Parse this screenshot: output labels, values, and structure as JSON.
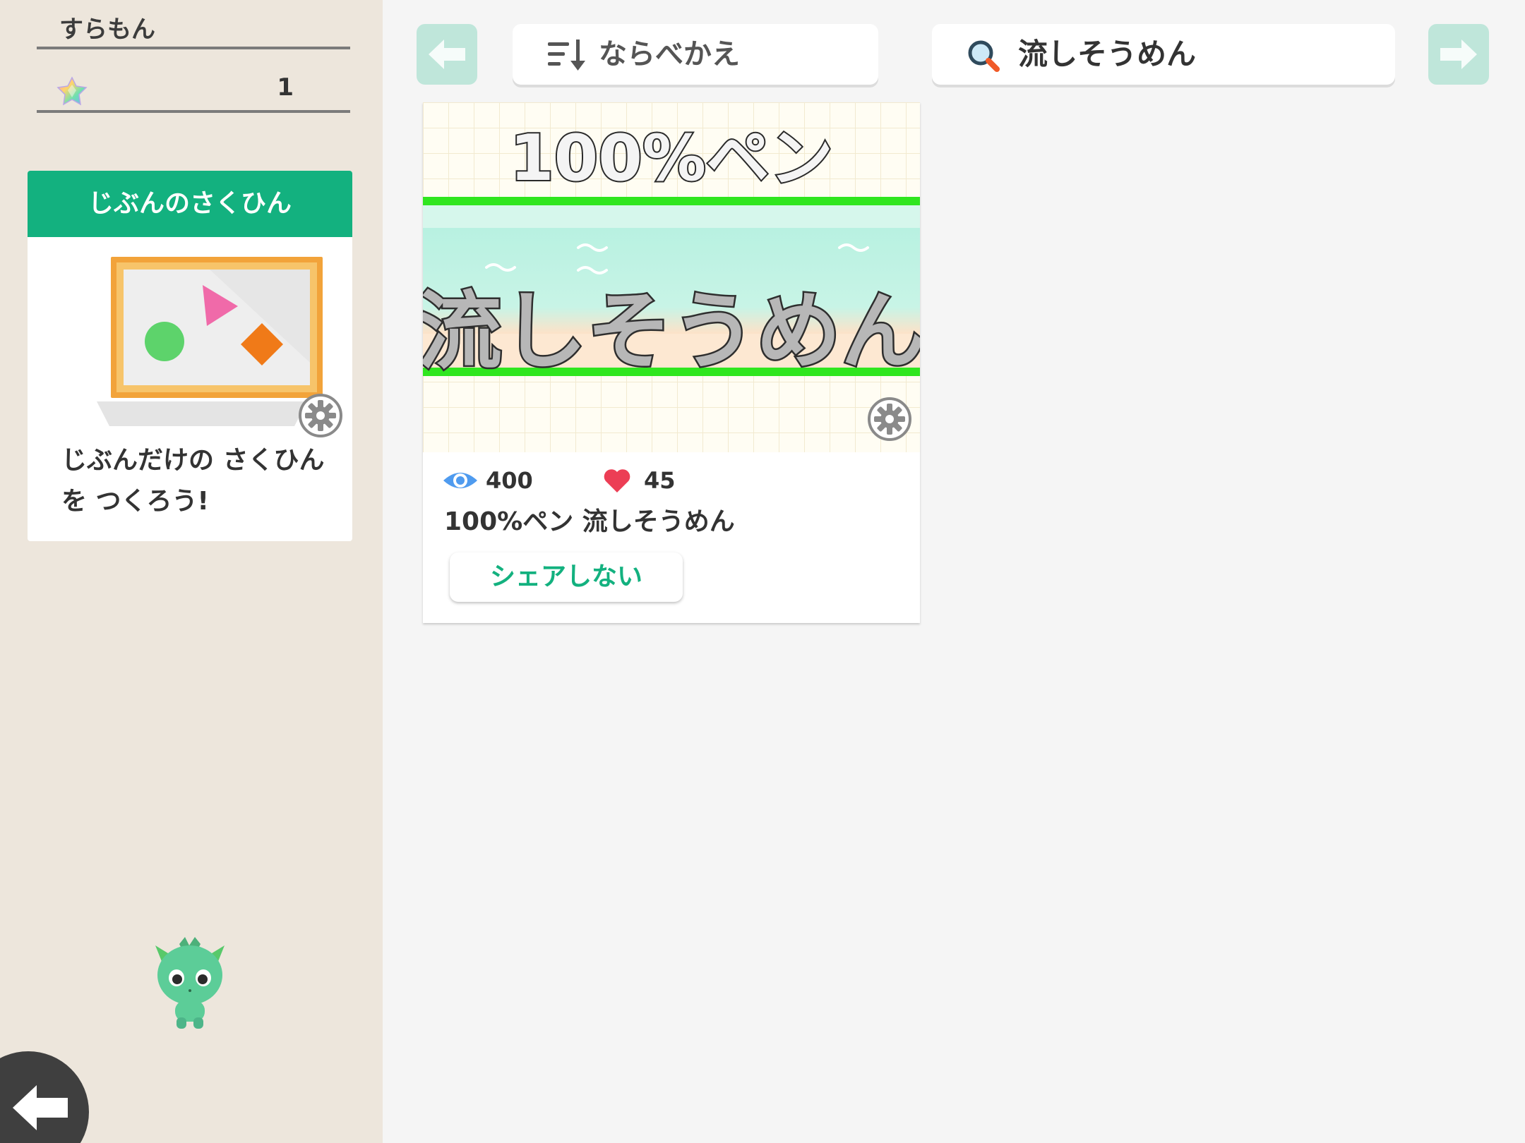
{
  "sidebar": {
    "username": "すらもん",
    "gem_count": "1",
    "own_works_card": {
      "header": "じぶんのさくひん",
      "message": "じぶんだけの さくひんを つくろう!"
    }
  },
  "toolbar": {
    "sort_label": "ならべかえ",
    "search_value": "流しそうめん"
  },
  "works": [
    {
      "title": "100%ペン 流しそうめん",
      "views": "400",
      "likes": "45",
      "share_label": "シェアしない",
      "thumbnail_top_text": "100%ペン",
      "thumbnail_bottom_text": "流しそうめん"
    }
  ],
  "colors": {
    "accent_green": "#13b17f",
    "sidebar_bg": "#ede6dc",
    "main_bg": "#f5f5f5",
    "nav_arrow_bg": "#bfe6da",
    "heart": "#ec3e55",
    "eye": "#4f9bef"
  },
  "icons": {
    "gem": "rainbow-star-gem-icon",
    "sort": "sort-lines-down-arrow-icon",
    "search": "magnifier-icon",
    "views": "eye-icon",
    "likes": "heart-icon",
    "settings": "gear-icon",
    "back": "left-arrow-icon",
    "prev_page": "left-arrow-icon",
    "next_page": "right-arrow-icon",
    "mascot": "green-creature-mascot"
  }
}
